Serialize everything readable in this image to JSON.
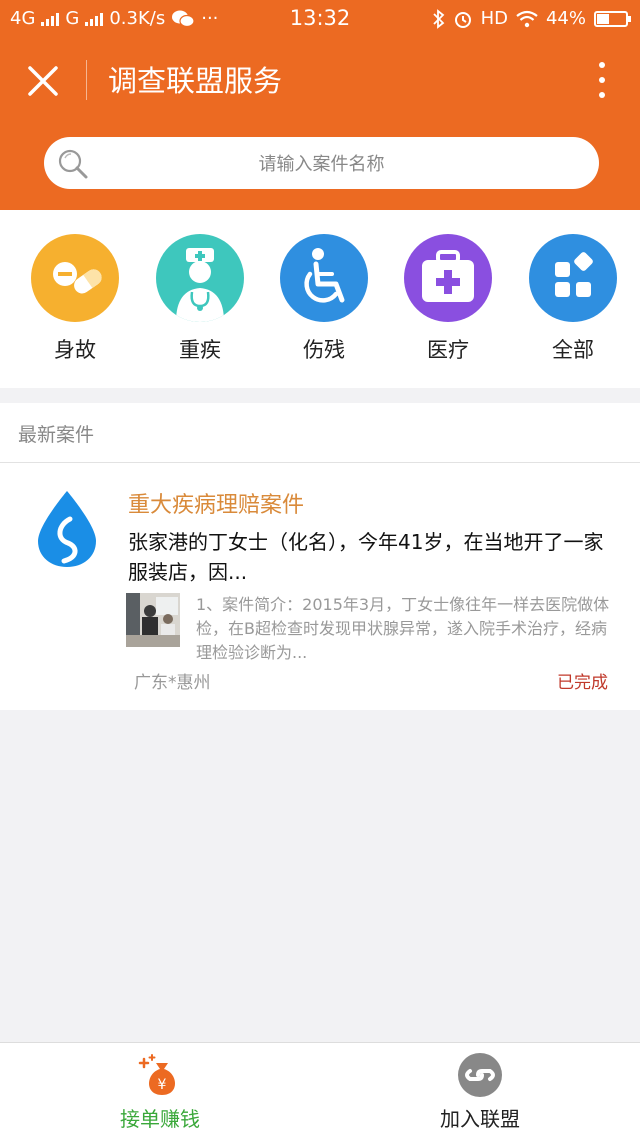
{
  "status_bar": {
    "net1": "4G",
    "net2": "G",
    "speed": "0.3K/s",
    "dots": "···",
    "time": "13:32",
    "hd": "HD",
    "battery": "44%",
    "battery_level": 0.44
  },
  "header": {
    "title": "调查联盟服务",
    "close_icon": "close-icon",
    "more_icon": "more-vertical-icon"
  },
  "search": {
    "placeholder": "请输入案件名称",
    "icon": "search-icon"
  },
  "categories": [
    {
      "label": "身故",
      "icon": "pills-icon",
      "color": "#f6b02f"
    },
    {
      "label": "重疾",
      "icon": "doctor-icon",
      "color": "#3ec7bd"
    },
    {
      "label": "伤残",
      "icon": "wheelchair-icon",
      "color": "#2f8fe0"
    },
    {
      "label": "医疗",
      "icon": "medical-kit-icon",
      "color": "#8a4fe0"
    },
    {
      "label": "全部",
      "icon": "all-grid-icon",
      "color": "#2f8fe0"
    }
  ],
  "section": {
    "title": "最新案件"
  },
  "cases": [
    {
      "logo": "water-drop-icon",
      "title": "重大疾病理赔案件",
      "summary": "张家港的丁女士（化名），今年41岁，在当地开了一家服装店，因...",
      "desc": "1、案件简介：2015年3月，丁女士像往年一样去医院做体检，在B超检查时发现甲状腺异常，遂入院手术治疗，经病理检验诊断为...",
      "location": "广东*惠州",
      "status": "已完成"
    }
  ],
  "tabbar": {
    "tabs": [
      {
        "label": "接单赚钱",
        "icon": "money-bag-icon",
        "active": true,
        "color": "#3aa83a"
      },
      {
        "label": "加入联盟",
        "icon": "link-icon",
        "active": false,
        "color": "#222222"
      }
    ]
  },
  "colors": {
    "brand": "#ec6a22",
    "case_title": "#d98a3a",
    "status_done": "#c0392b"
  }
}
